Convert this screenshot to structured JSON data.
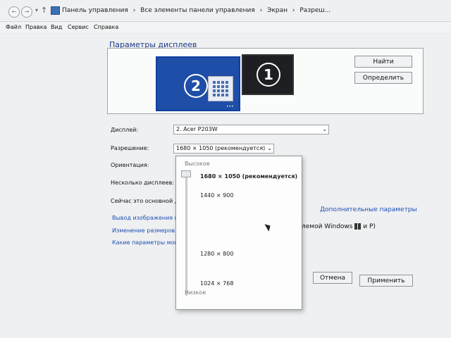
{
  "breadcrumb": [
    "Панель управления",
    "›",
    "Все элементы панели управления",
    "›",
    "Экран",
    "›",
    "Разреш..."
  ],
  "menu": [
    "Файл",
    "Правка",
    "Вид",
    "Сервис",
    "Справка"
  ],
  "page_title": "Параметры дисплеев",
  "monitors": [
    {
      "number": "2"
    },
    {
      "number": "1"
    }
  ],
  "buttons": {
    "find": "Найти",
    "identify": "Определить",
    "cancel": "Отмена",
    "apply": "Применить"
  },
  "labels": {
    "display": "Дисплей:",
    "resolution": "Разрешение:",
    "orientation": "Ориентация:",
    "multiple": "Несколько дисплеев:",
    "main": "Сейчас это основной д"
  },
  "display_value": "2. Acer P203W",
  "resolution_value": "1680 × 1050 (рекомендуется)",
  "links": {
    "advanced": "Дополнительные параметры",
    "output": "Вывод изображения на",
    "resize": "Изменение размеров те",
    "which": "Какие параметры мони"
  },
  "windows_hint": "лемой Windows",
  "windows_hint_tail": "и P)",
  "dropdown": {
    "high": "Высокое",
    "low": "Низкое",
    "options": [
      "1680 × 1050 (рекомендуется)",
      "1440 × 900",
      "1280 × 800",
      "1024 × 768"
    ],
    "selected_index": 0
  },
  "colors": {
    "link": "#1f4fb5",
    "monitor_selected": "#1f4ea8",
    "monitor_other": "#1e1f22"
  },
  "icons": [
    "back-icon",
    "forward-icon",
    "up-icon",
    "control-panel-icon",
    "windows-logo-icon"
  ]
}
